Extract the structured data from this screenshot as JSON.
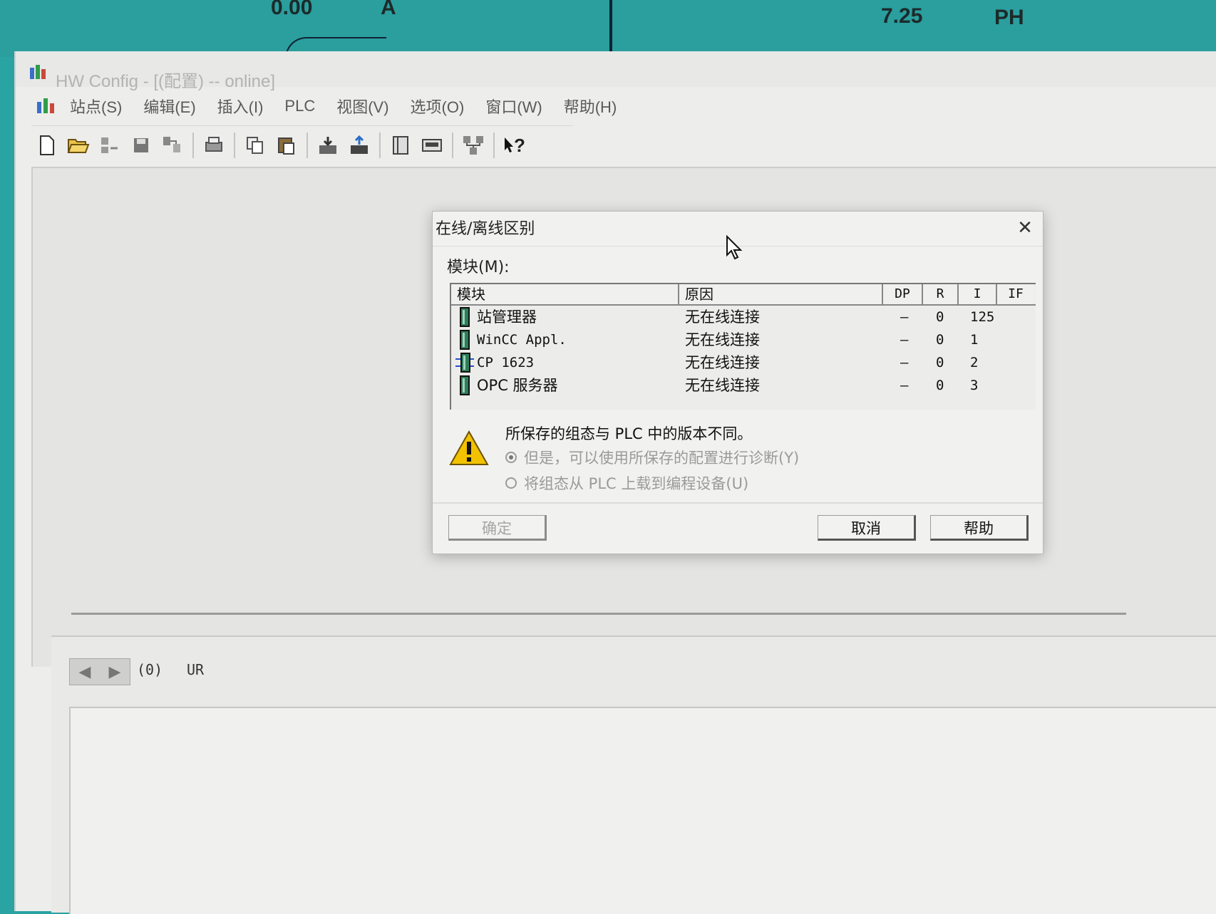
{
  "background_hmi": {
    "value_a": "0.00",
    "unit_a": "A",
    "value_ph": "7.25",
    "unit_ph": "PH"
  },
  "window": {
    "title": "HW Config - [(配置) -- online]",
    "menu": [
      "站点(S)",
      "编辑(E)",
      "插入(I)",
      "PLC",
      "视图(V)",
      "选项(O)",
      "窗口(W)",
      "帮助(H)"
    ],
    "toolbar_icons": [
      "new-icon",
      "open-icon",
      "save-compile-icon",
      "save-icon",
      "network-icon",
      "print-icon",
      "copy-icon",
      "paste-icon",
      "download-icon",
      "upload-icon",
      "catalog-icon",
      "module-info-icon",
      "network-config-icon",
      "context-help-icon"
    ],
    "help_glyph": "?"
  },
  "station": {
    "rack_number": "(0)",
    "rack_name": "UR"
  },
  "dialog": {
    "title": "在线/离线区别",
    "close_glyph": "✕",
    "module_label": "模块(M):",
    "columns": [
      "模块",
      "原因",
      "DP",
      "R",
      "I",
      "IF"
    ],
    "rows": [
      {
        "module": "站管理器",
        "reason": "无在线连接",
        "dp": "–",
        "r": "0",
        "i": "125",
        "if": ""
      },
      {
        "module": "WinCC Appl.",
        "reason": "无在线连接",
        "dp": "–",
        "r": "0",
        "i": "1",
        "if": ""
      },
      {
        "module": "CP 1623",
        "reason": "无在线连接",
        "dp": "–",
        "r": "0",
        "i": "2",
        "if": ""
      },
      {
        "module": "OPC 服务器",
        "reason": "无在线连接",
        "dp": "–",
        "r": "0",
        "i": "3",
        "if": ""
      }
    ],
    "warning_message": "所保存的组态与 PLC 中的版本不同。",
    "option_1": "但是，可以使用所保存的配置进行诊断(Y)",
    "option_2": "将组态从 PLC 上载到编程设备(U)",
    "ok_label": "确定",
    "cancel_label": "取消",
    "help_label": "帮助"
  },
  "colors": {
    "hmi_background": "#2aa3a3",
    "window_background": "#ededeb",
    "dialog_background": "#f1f1ef",
    "warning_yellow": "#f2c200"
  }
}
